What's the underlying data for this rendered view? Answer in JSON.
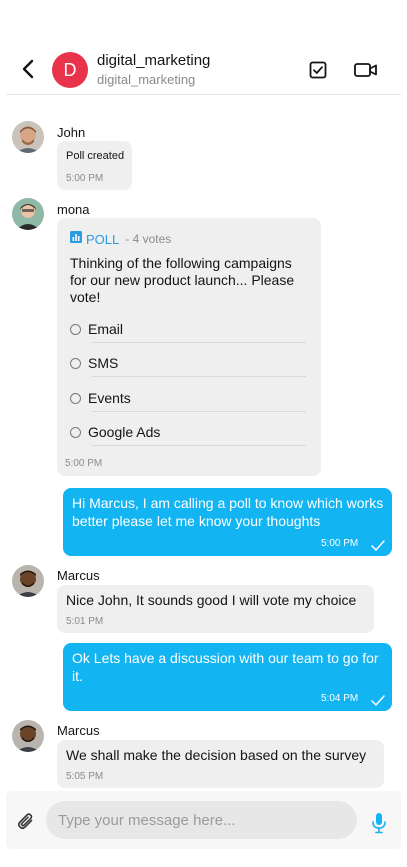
{
  "header": {
    "group_initial": "D",
    "title": "digital_marketing",
    "subtitle": "digital_marketing",
    "accent": "#e8334b"
  },
  "messages": [
    {
      "sender": "John",
      "text": "Poll created",
      "time": "5:00 PM",
      "direction": "incoming"
    },
    {
      "sender": "mona",
      "type": "poll",
      "poll_label": "POLL",
      "votes": "- 4 votes",
      "question": "Thinking of the following campaigns for our new product launch... Please vote!",
      "options": [
        "Email",
        "SMS",
        "Events",
        "Google Ads"
      ],
      "time": "5:00 PM",
      "direction": "incoming"
    },
    {
      "text": "Hi Marcus, I am calling a poll to know which works better please let me know your thoughts",
      "time": "5:00 PM",
      "direction": "outgoing"
    },
    {
      "sender": "Marcus",
      "text": "Nice John, It sounds good I will vote my choice",
      "time": "5:01 PM",
      "direction": "incoming"
    },
    {
      "text": "Ok Lets have a discussion with our team to go for it.",
      "time": "5:04 PM",
      "direction": "outgoing"
    },
    {
      "sender": "Marcus",
      "text": "We shall make the decision based on the survey",
      "time": "5:05 PM",
      "direction": "incoming"
    }
  ],
  "composer": {
    "placeholder": "Type your message here...",
    "value": ""
  },
  "colors": {
    "outgoing_bubble": "#13b4f2",
    "incoming_bubble": "#efefef",
    "poll_accent": "#2a9cdf"
  },
  "icons": [
    "back-arrow-icon",
    "poll-icon",
    "video-call-icon",
    "attachment-icon",
    "microphone-icon",
    "bar-chart-icon",
    "check-icon"
  ]
}
